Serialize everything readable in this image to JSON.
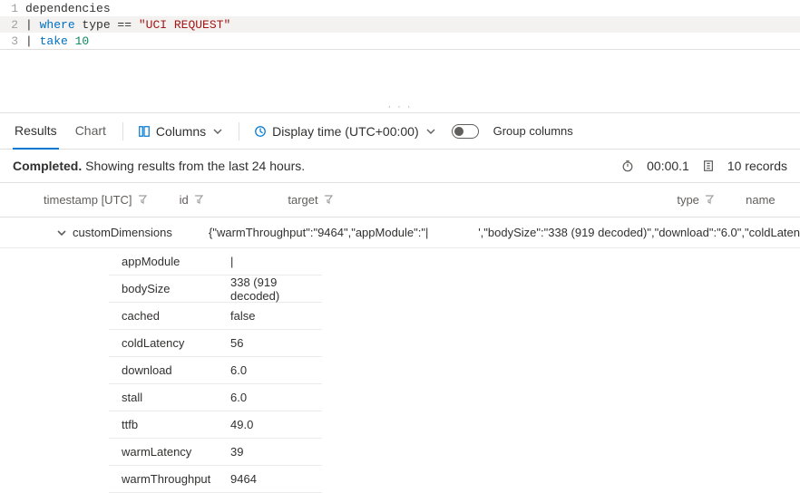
{
  "editor": {
    "lines": [
      {
        "n": "1",
        "table": "dependencies"
      },
      {
        "n": "2",
        "pipe": "| ",
        "kw": "where",
        "rest": " type == ",
        "str": "\"UCI REQUEST\""
      },
      {
        "n": "3",
        "pipe": "| ",
        "kw": "take",
        "num": " 10"
      }
    ]
  },
  "tabs": {
    "results": "Results",
    "chart": "Chart",
    "columns": "Columns",
    "display_time": "Display time (UTC+00:00)",
    "group_columns": "Group columns"
  },
  "status": {
    "completed": "Completed.",
    "detail": " Showing results from the last 24 hours.",
    "elapsed": "00:00.1",
    "records": "10 records"
  },
  "columns": {
    "timestamp": "timestamp [UTC]",
    "id": "id",
    "target": "target",
    "type": "type",
    "name": "name"
  },
  "expanded": {
    "key": "customDimensions",
    "valLeft": "{\"warmThroughput\":\"9464\",\"appModule\":\"|",
    "valRight": "',\"bodySize\":\"338 (919 decoded)\",\"download\":\"6.0\",\"coldLaten"
  },
  "kv": [
    {
      "k": "appModule",
      "v": "|"
    },
    {
      "k": "bodySize",
      "v": "338 (919 decoded)"
    },
    {
      "k": "cached",
      "v": "false"
    },
    {
      "k": "coldLatency",
      "v": "56"
    },
    {
      "k": "download",
      "v": "6.0"
    },
    {
      "k": "stall",
      "v": "6.0"
    },
    {
      "k": "ttfb",
      "v": "49.0"
    },
    {
      "k": "warmLatency",
      "v": "39"
    },
    {
      "k": "warmThroughput",
      "v": "9464"
    }
  ]
}
